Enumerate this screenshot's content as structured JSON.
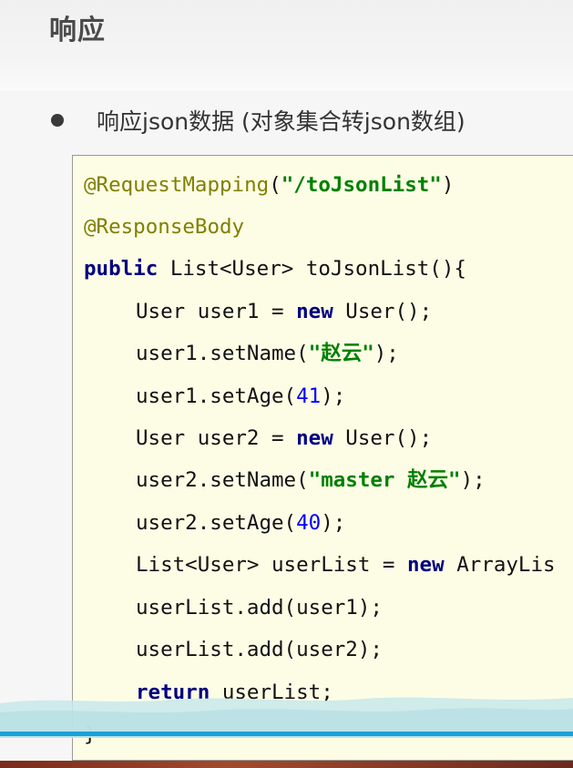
{
  "slide": {
    "title": "响应"
  },
  "bullet": {
    "text": "响应json数据 (对象集合转json数组)"
  },
  "code": {
    "line1": {
      "annotation": "@RequestMapping",
      "open": "(",
      "string": "\"/toJsonList\"",
      "close": ")"
    },
    "line2": {
      "annotation": "@ResponseBody"
    },
    "line3": {
      "keyword": "public",
      "rest": " List<User> toJsonList(){"
    },
    "line4": {
      "pre": "User user1 = ",
      "keyword": "new",
      "post": " User();"
    },
    "line5": {
      "pre": "user1.setName(",
      "string": "\"赵云\"",
      "post": ");"
    },
    "line6": {
      "pre": "user1.setAge(",
      "number": "41",
      "post": ");"
    },
    "line7": {
      "pre": "User user2 = ",
      "keyword": "new",
      "post": " User();"
    },
    "line8": {
      "pre": "user2.setName(",
      "string": "\"master 赵云\"",
      "post": ");"
    },
    "line9": {
      "pre": "user2.setAge(",
      "number": "40",
      "post": ");"
    },
    "line10": {
      "pre": "List<User> userList = ",
      "keyword": "new",
      "post": " ArrayLis"
    },
    "line11": {
      "text": "userList.add(user1);"
    },
    "line12": {
      "text": "userList.add(user2);"
    },
    "line13": {
      "keyword": "return",
      "post": " userList;"
    },
    "line14": {
      "text": "}"
    }
  },
  "colors": {
    "annotation": "#808000",
    "keyword": "#000080",
    "string": "#008000",
    "number": "#0000ff",
    "code_background": "#fdfde6",
    "accent_line": "#1aa0d8"
  }
}
